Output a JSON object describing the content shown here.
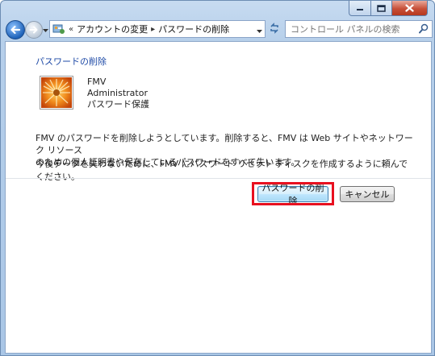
{
  "window": {
    "controls": {
      "minimize": "minimize-icon",
      "maximize": "maximize-icon",
      "close": "close-icon"
    }
  },
  "nav": {
    "back_icon": "back-arrow-icon",
    "forward_icon": "forward-arrow-icon",
    "address": {
      "overflow": "«",
      "crumbs": [
        "アカウントの変更",
        "パスワードの削除"
      ]
    },
    "search": {
      "placeholder": "コントロール パネルの検索"
    }
  },
  "page": {
    "title": "パスワードの削除",
    "account": {
      "name": "FMV",
      "type": "Administrator",
      "status": "パスワード保護"
    },
    "description_line1": "FMV のパスワードを削除しようとしています。削除すると、FMV は Web サイトやネットワーク リソース",
    "description_line2": "のための個人証明書や保存しているパスワードをすべて失います。",
    "description2": "今後データを失わないために、FMV にパスワード リセット ディスクを作成するように頼んでください。",
    "buttons": {
      "remove": "パスワードの削除",
      "cancel": "キャンセル"
    }
  },
  "colors": {
    "title": "#1e4aa6",
    "highlight": "#e8101f",
    "close_button": "#c74f38"
  }
}
